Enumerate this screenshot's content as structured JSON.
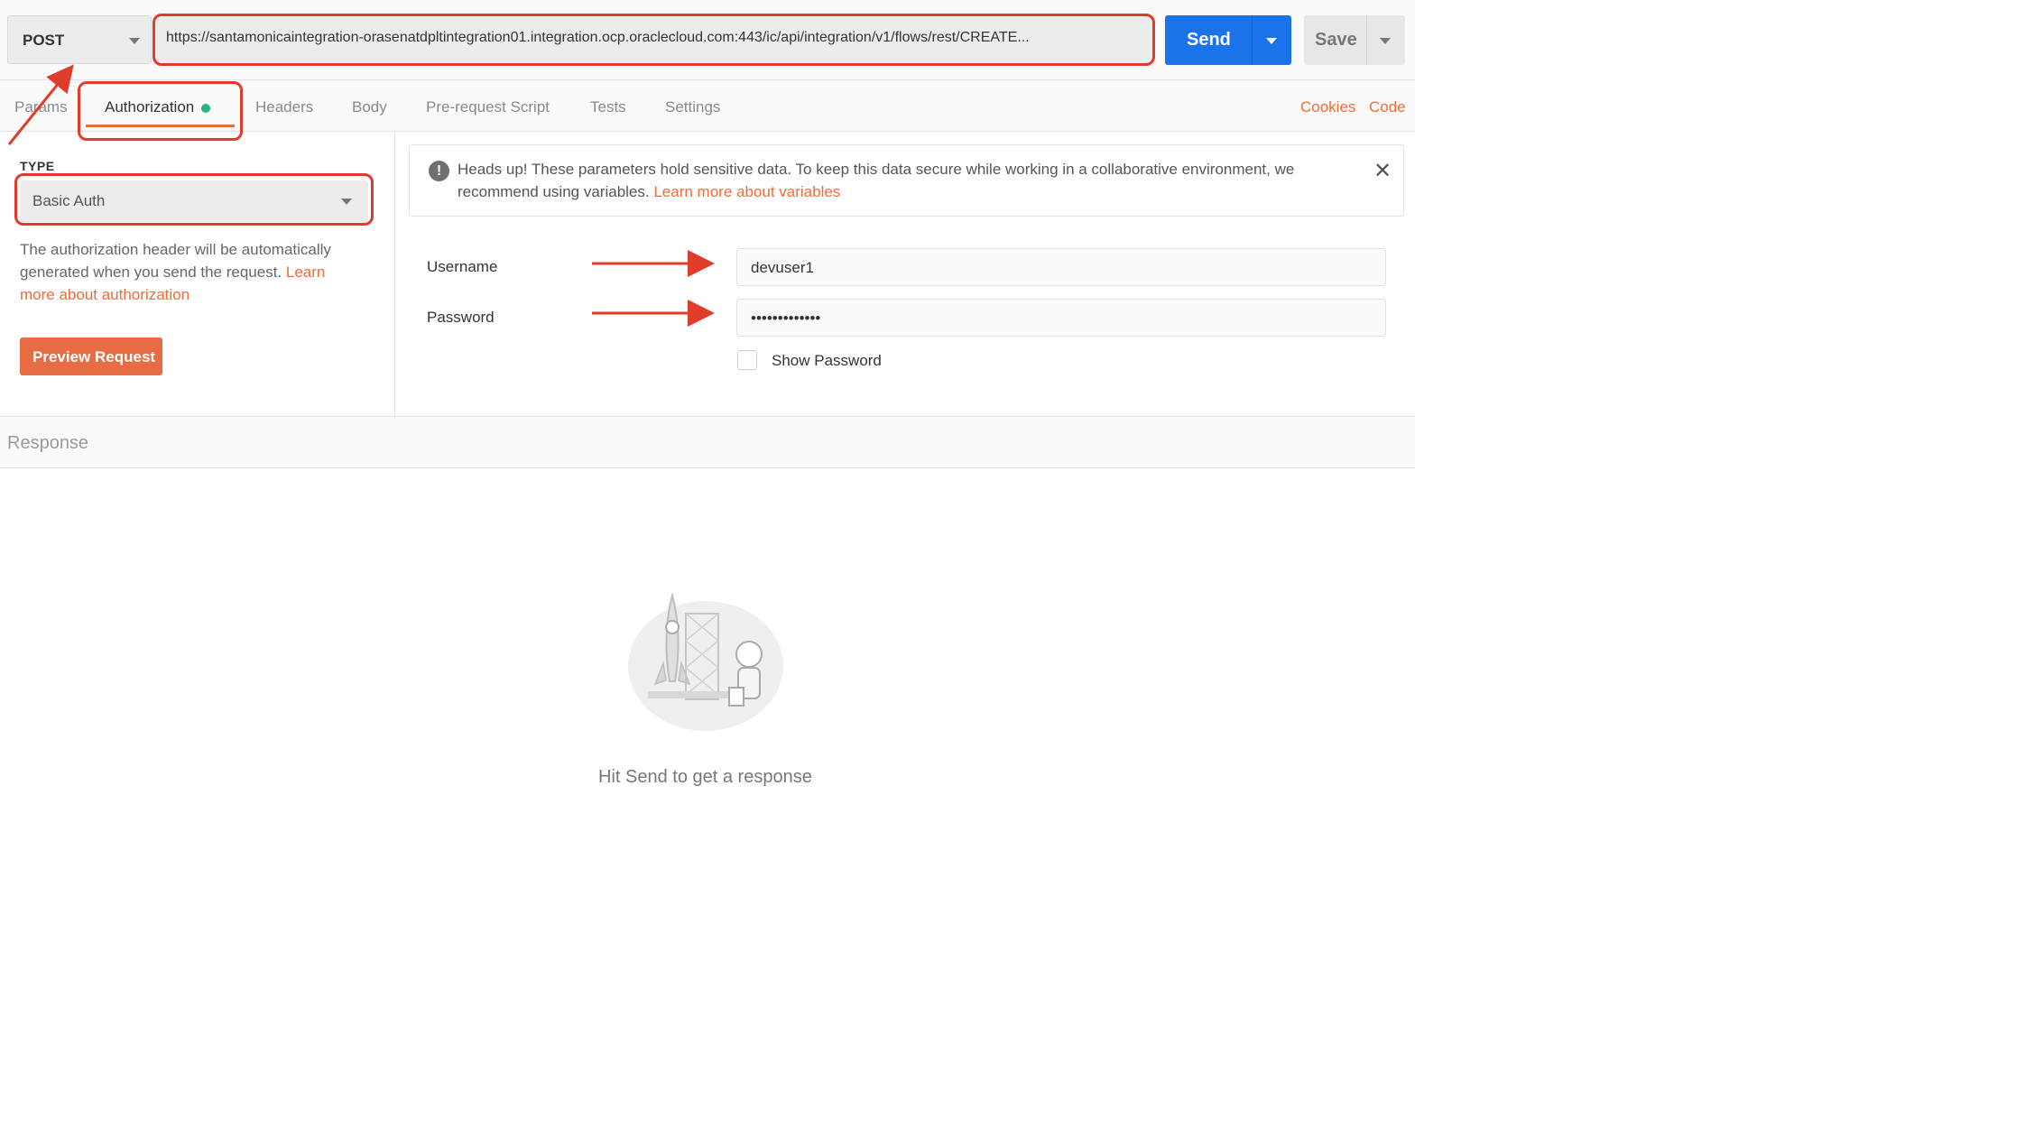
{
  "request": {
    "method": "POST",
    "url": "https://santamonicaintegration-orasenatdpltintegration01.integration.ocp.oraclecloud.com:443/ic/api/integration/v1/flows/rest/CREATE...",
    "send_label": "Send",
    "save_label": "Save"
  },
  "tabs": [
    {
      "label": "Params"
    },
    {
      "label": "Authorization"
    },
    {
      "label": "Headers"
    },
    {
      "label": "Body"
    },
    {
      "label": "Pre-request Script"
    },
    {
      "label": "Tests"
    },
    {
      "label": "Settings"
    }
  ],
  "links": {
    "cookies": "Cookies",
    "code": "Code"
  },
  "auth": {
    "type_label": "TYPE",
    "type_value": "Basic Auth",
    "description": "The authorization header will be automatically generated when you send the request.",
    "learn_link": "Learn more about authorization",
    "preview_label": "Preview Request"
  },
  "notice": {
    "text": "Heads up! These parameters hold sensitive data. To keep this data secure while working in a collaborative environment, we recommend using variables.",
    "link": "Learn more about variables",
    "close": "✕"
  },
  "form": {
    "username_label": "Username",
    "username_value": "devuser1",
    "password_label": "Password",
    "password_value": "•••••••••••••",
    "show_password_label": "Show Password"
  },
  "response": {
    "title": "Response",
    "hint": "Hit Send to get a response"
  },
  "colors": {
    "accent": "#f26b3a",
    "send": "#1a73e8",
    "annotation": "#e03c2c",
    "dot": "#26b47f"
  }
}
